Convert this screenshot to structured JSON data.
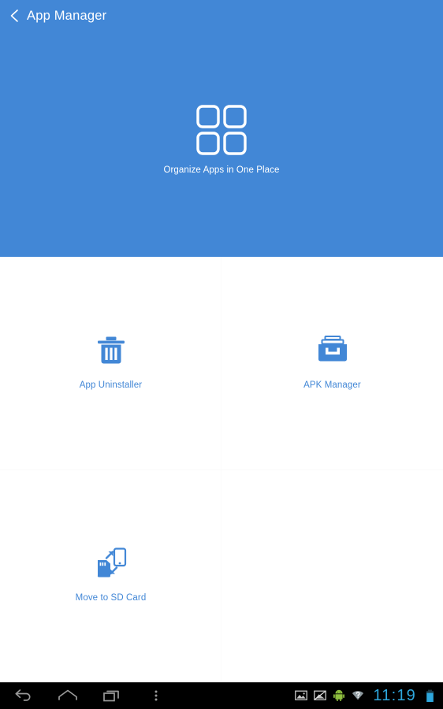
{
  "app": {
    "title": "App Manager",
    "back_icon": "chevron-left-icon",
    "header_color": "#4287d6",
    "accent_color": "#4287d6",
    "background_color": "#ffffff"
  },
  "hero": {
    "icon": "app-grid-icon",
    "caption": "Organize Apps in One Place"
  },
  "tools": [
    {
      "label": "App Uninstaller",
      "icon": "trash-icon"
    },
    {
      "label": "APK Manager",
      "icon": "inbox-tray-icon"
    },
    {
      "label": "Move to SD Card",
      "icon": "sd-card-transfer-icon"
    },
    {
      "label": "",
      "icon": ""
    }
  ],
  "system_bar": {
    "nav": [
      {
        "name": "back",
        "icon": "back-arrow-icon"
      },
      {
        "name": "home",
        "icon": "home-icon"
      },
      {
        "name": "recents",
        "icon": "recents-icon"
      },
      {
        "name": "menu",
        "icon": "overflow-menu-icon"
      }
    ],
    "status_icons": [
      {
        "name": "screenshot",
        "icon": "image-icon"
      },
      {
        "name": "screenshot-capture",
        "icon": "image-slash-icon"
      },
      {
        "name": "usb-debugging",
        "icon": "android-robot-icon"
      },
      {
        "name": "wifi-unknown",
        "icon": "wifi-question-icon"
      }
    ],
    "clock": "11:19",
    "battery": {
      "icon": "battery-icon",
      "level": "full"
    },
    "clock_color": "#2ea7dd"
  }
}
